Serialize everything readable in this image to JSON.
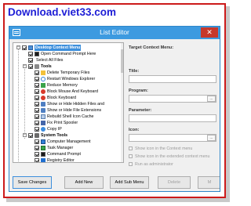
{
  "banner": {
    "text": "Download.viet33.com"
  },
  "window": {
    "title": "List Editor",
    "close_glyph": "✕"
  },
  "tree": {
    "items": [
      {
        "label": "Desktop Context Menu",
        "level": 0,
        "bold": true,
        "selected": true,
        "expander": "−",
        "icon": "desktop-icon"
      },
      {
        "label": "Open Command Prompt Here",
        "level": 1,
        "icon": "cmd-icon"
      },
      {
        "label": "Select All Files",
        "level": 1,
        "icon": "none"
      },
      {
        "label": "Tools",
        "level": 1,
        "bold": true,
        "expander": "−",
        "icon": "tools-icon"
      },
      {
        "label": "Delete Temporary Files",
        "level": 2,
        "icon": "folder-icon"
      },
      {
        "label": "Restart Windows Explorer",
        "level": 2,
        "icon": "refresh-icon"
      },
      {
        "label": "Reduce Memory",
        "level": 2,
        "icon": "memory-icon"
      },
      {
        "label": "Block Mouse And Keyboard",
        "level": 2,
        "icon": "block-icon"
      },
      {
        "label": "Block Keyboard",
        "level": 2,
        "icon": "block-icon"
      },
      {
        "label": "Show or Hide Hidden Files and",
        "level": 2,
        "icon": "eye-icon"
      },
      {
        "label": "Show or Hide File Extensions",
        "level": 2,
        "icon": "eye-icon"
      },
      {
        "label": "Rebuild Shell Icon Cache",
        "level": 2,
        "icon": "rebuild-icon"
      },
      {
        "label": "Fix Print Spooler",
        "level": 2,
        "icon": "printer-icon"
      },
      {
        "label": "Copy IP",
        "level": 2,
        "icon": "globe-icon"
      },
      {
        "label": "System Tools",
        "level": 1,
        "bold": true,
        "expander": "−",
        "icon": "system-tools-icon"
      },
      {
        "label": "Computer Management",
        "level": 2,
        "icon": "computer-icon"
      },
      {
        "label": "Task Manager",
        "level": 2,
        "icon": "task-icon"
      },
      {
        "label": "Command Prompt",
        "level": 2,
        "icon": "cmd-icon"
      },
      {
        "label": "Registry Editor",
        "level": 2,
        "icon": "registry-icon"
      }
    ]
  },
  "form": {
    "target_label": "Target Context Menu:",
    "title_label": "Title:",
    "program_label": "Program:",
    "parameter_label": "Parameter:",
    "icon_label": "Icon:",
    "browse_label": "...",
    "title_value": "",
    "program_value": "",
    "parameter_value": "",
    "icon_value": "",
    "options": [
      "Show icon in the Context menu",
      "Show icon in the extended context menu",
      "Run as administrator"
    ]
  },
  "buttons": {
    "save": "Save Changes",
    "add_new": "Add New",
    "add_sub": "Add Sub Menu",
    "delete": "Delete",
    "more": "M"
  },
  "colors": {
    "accent": "#3d9ae0",
    "banner": "#1d1dd6",
    "frame": "#cc1a1a"
  }
}
